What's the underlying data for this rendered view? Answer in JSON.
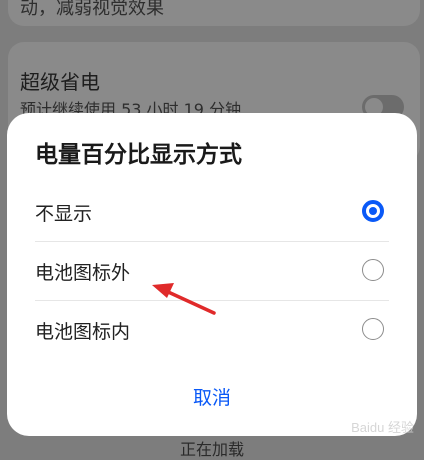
{
  "background": {
    "top_text": "动，减弱视觉效果",
    "setting_title": "超级省电",
    "setting_sub": "预计继续使用 53 小时 19 分钟",
    "bottom_text": "正在加载"
  },
  "dialog": {
    "title": "电量百分比显示方式",
    "options": [
      {
        "label": "不显示",
        "selected": true
      },
      {
        "label": "电池图标外",
        "selected": false
      },
      {
        "label": "电池图标内",
        "selected": false
      }
    ],
    "cancel": "取消"
  },
  "watermark": "Baidu 经验",
  "colors": {
    "accent": "#0a59f7",
    "annotation_arrow": "#e02a2a"
  }
}
